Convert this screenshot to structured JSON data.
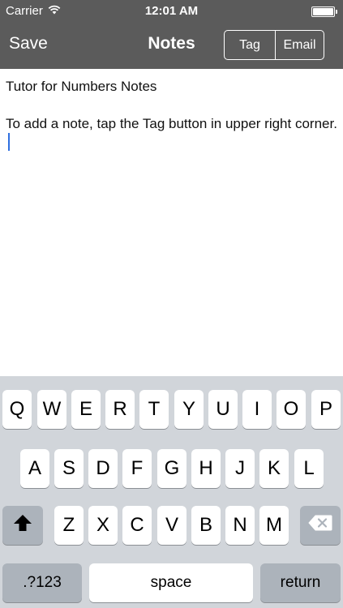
{
  "status": {
    "carrier": "Carrier",
    "time": "12:01 AM"
  },
  "nav": {
    "save_label": "Save",
    "title": "Notes",
    "tag_label": "Tag",
    "email_label": "Email"
  },
  "editor": {
    "line1": "Tutor for Numbers Notes",
    "line2": "To add a note, tap the Tag button in upper right corner."
  },
  "keyboard": {
    "row1": [
      "Q",
      "W",
      "E",
      "R",
      "T",
      "Y",
      "U",
      "I",
      "O",
      "P"
    ],
    "row2": [
      "A",
      "S",
      "D",
      "F",
      "G",
      "H",
      "J",
      "K",
      "L"
    ],
    "row3": [
      "Z",
      "X",
      "C",
      "V",
      "B",
      "N",
      "M"
    ],
    "numbers_label": ".?123",
    "space_label": "space",
    "return_label": "return"
  },
  "icons": {
    "wifi": "wifi-icon",
    "battery": "battery-icon",
    "shift": "shift-icon",
    "delete": "delete-icon"
  }
}
